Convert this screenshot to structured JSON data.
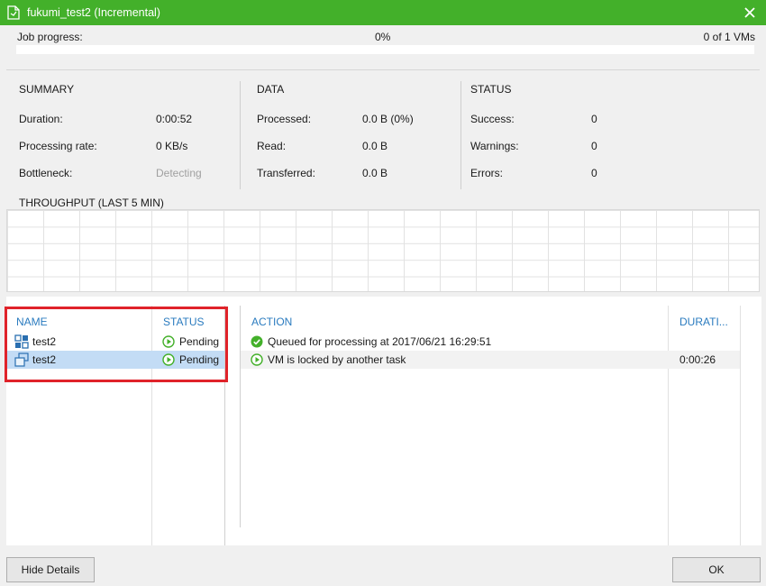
{
  "window": {
    "title": "fukumi_test2 (Incremental)",
    "accent": "#43b02a"
  },
  "progress": {
    "label": "Job progress:",
    "percent_text": "0%",
    "percent_value": 0,
    "vm_count": "0 of 1 VMs"
  },
  "summary": {
    "heading": "SUMMARY",
    "duration_label": "Duration:",
    "duration_value": "0:00:52",
    "rate_label": "Processing rate:",
    "rate_value": "0 KB/s",
    "bottleneck_label": "Bottleneck:",
    "bottleneck_value": "Detecting"
  },
  "data": {
    "heading": "DATA",
    "processed_label": "Processed:",
    "processed_value": "0.0 B (0%)",
    "read_label": "Read:",
    "read_value": "0.0 B",
    "transferred_label": "Transferred:",
    "transferred_value": "0.0 B"
  },
  "status": {
    "heading": "STATUS",
    "success_label": "Success:",
    "success_value": "0",
    "warnings_label": "Warnings:",
    "warnings_value": "0",
    "errors_label": "Errors:",
    "errors_value": "0"
  },
  "throughput": {
    "heading": "THROUGHPUT (LAST 5 MIN)"
  },
  "vm_table": {
    "headers": {
      "name": "NAME",
      "status": "STATUS"
    },
    "rows": [
      {
        "name": "test2",
        "status": "Pending",
        "selected": false,
        "icon": "vm-group-icon"
      },
      {
        "name": "test2",
        "status": "Pending",
        "selected": true,
        "icon": "vm-icon"
      }
    ]
  },
  "action_table": {
    "headers": {
      "action": "ACTION",
      "duration": "DURATI..."
    },
    "rows": [
      {
        "action": "Queued for processing at 2017/06/21 16:29:51",
        "duration": "",
        "icon": "success-check-icon"
      },
      {
        "action": "VM is locked by another task",
        "duration": "0:00:26",
        "icon": "pending-play-icon"
      }
    ]
  },
  "buttons": {
    "hide_details": "Hide Details",
    "ok": "OK"
  }
}
